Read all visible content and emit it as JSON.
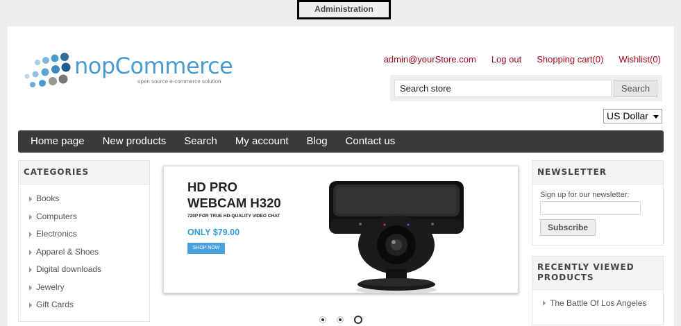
{
  "admin_bar": {
    "label": "Administration"
  },
  "logo": {
    "text": "nopCommerce",
    "tagline": "open source e-commerce solution"
  },
  "header_links": {
    "account": "admin@yourStore.com",
    "logout": "Log out",
    "cart": "Shopping cart(0)",
    "wishlist": "Wishlist(0)"
  },
  "search": {
    "placeholder": "Search store",
    "button": "Search"
  },
  "currency": {
    "selected": "US Dollar"
  },
  "nav": [
    "Home page",
    "New products",
    "Search",
    "My account",
    "Blog",
    "Contact us"
  ],
  "categories": {
    "title": "CATEGORIES",
    "items": [
      "Books",
      "Computers",
      "Electronics",
      "Apparel & Shoes",
      "Digital downloads",
      "Jewelry",
      "Gift Cards"
    ]
  },
  "slider": {
    "title_line1": "HD PRO",
    "title_line2": "WEBCAM H320",
    "subtitle": "720P FOR TRUE HD-QUALITY VIDEO CHAT",
    "price": "ONLY $79.00",
    "cta": "SHOP NOW",
    "slide_count": 3,
    "active_slide": 3
  },
  "newsletter": {
    "title": "NEWSLETTER",
    "label": "Sign up for our newsletter:",
    "button": "Subscribe"
  },
  "recently_viewed": {
    "title": "RECENTLY VIEWED PRODUCTS",
    "items": [
      "The Battle Of Los Angeles"
    ]
  },
  "colors": {
    "link": "#a3061f",
    "nav_bg": "#3b3b3b",
    "logo_blue": "#4b9bd1",
    "price_blue": "#2e9ad6"
  }
}
